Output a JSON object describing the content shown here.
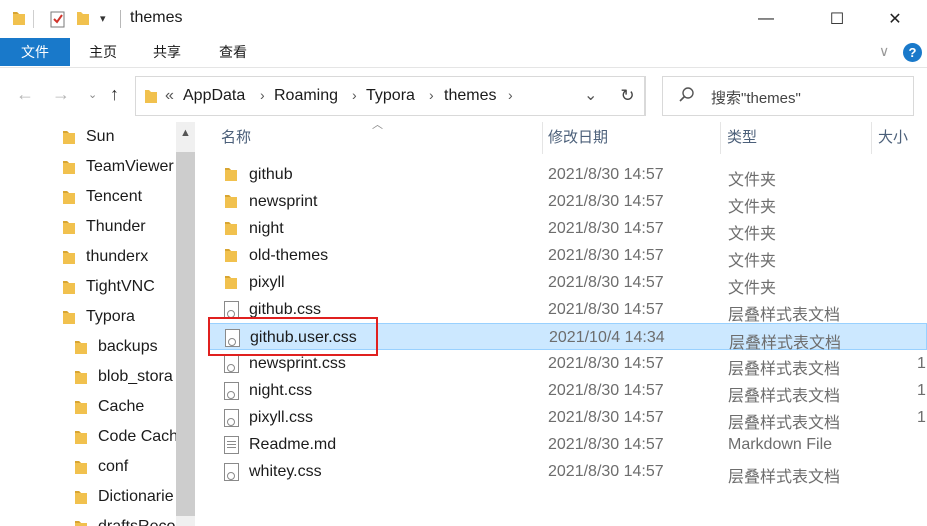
{
  "window": {
    "title": "themes",
    "minimize": "—",
    "maximize": "☐",
    "close": "✕"
  },
  "ribbon": {
    "tabs": [
      "文件",
      "主页",
      "共享",
      "查看"
    ],
    "help": "?",
    "expand": "∨"
  },
  "address": {
    "overflow": "«",
    "crumbs": [
      "AppData",
      "Roaming",
      "Typora",
      "themes"
    ],
    "dropdown": "⌄",
    "refresh": "↻"
  },
  "search": {
    "placeholder": "搜索\"themes\""
  },
  "sidebar": {
    "items": [
      {
        "label": "Sun",
        "level": 0
      },
      {
        "label": "TeamViewer",
        "level": 0
      },
      {
        "label": "Tencent",
        "level": 0
      },
      {
        "label": "Thunder",
        "level": 0
      },
      {
        "label": "thunderx",
        "level": 0
      },
      {
        "label": "TightVNC",
        "level": 0
      },
      {
        "label": "Typora",
        "level": 0
      },
      {
        "label": "backups",
        "level": 1
      },
      {
        "label": "blob_stora",
        "level": 1
      },
      {
        "label": "Cache",
        "level": 1
      },
      {
        "label": "Code Cach",
        "level": 1
      },
      {
        "label": "conf",
        "level": 1
      },
      {
        "label": "Dictionarie",
        "level": 1
      },
      {
        "label": "draftsReco",
        "level": 1
      }
    ]
  },
  "columns": {
    "name": "名称",
    "date": "修改日期",
    "type": "类型",
    "size": "大小"
  },
  "files": [
    {
      "name": "github",
      "date": "2021/8/30 14:57",
      "type": "文件夹",
      "size": "",
      "icon": "folder-icon"
    },
    {
      "name": "newsprint",
      "date": "2021/8/30 14:57",
      "type": "文件夹",
      "size": "",
      "icon": "folder-icon"
    },
    {
      "name": "night",
      "date": "2021/8/30 14:57",
      "type": "文件夹",
      "size": "",
      "icon": "folder-icon"
    },
    {
      "name": "old-themes",
      "date": "2021/8/30 14:57",
      "type": "文件夹",
      "size": "",
      "icon": "folder-icon"
    },
    {
      "name": "pixyll",
      "date": "2021/8/30 14:57",
      "type": "文件夹",
      "size": "",
      "icon": "folder-icon"
    },
    {
      "name": "github.css",
      "date": "2021/8/30 14:57",
      "type": "层叠样式表文档",
      "size": "",
      "icon": "css-file-icon"
    },
    {
      "name": "github.user.css",
      "date": "2021/10/4 14:34",
      "type": "层叠样式表文档",
      "size": "",
      "icon": "css-file-icon",
      "selected": true
    },
    {
      "name": "newsprint.css",
      "date": "2021/8/30 14:57",
      "type": "层叠样式表文档",
      "size": "1",
      "icon": "css-file-icon"
    },
    {
      "name": "night.css",
      "date": "2021/8/30 14:57",
      "type": "层叠样式表文档",
      "size": "1",
      "icon": "css-file-icon"
    },
    {
      "name": "pixyll.css",
      "date": "2021/8/30 14:57",
      "type": "层叠样式表文档",
      "size": "1",
      "icon": "css-file-icon"
    },
    {
      "name": "Readme.md",
      "date": "2021/8/30 14:57",
      "type": "Markdown File",
      "size": "",
      "icon": "markdown-file-icon"
    },
    {
      "name": "whitey.css",
      "date": "2021/8/30 14:57",
      "type": "层叠样式表文档",
      "size": "",
      "icon": "css-file-icon"
    }
  ],
  "colors": {
    "accent": "#1979ca",
    "selection": "#cce8ff",
    "annotation": "#e0201f",
    "folder": "#f1c14e"
  }
}
